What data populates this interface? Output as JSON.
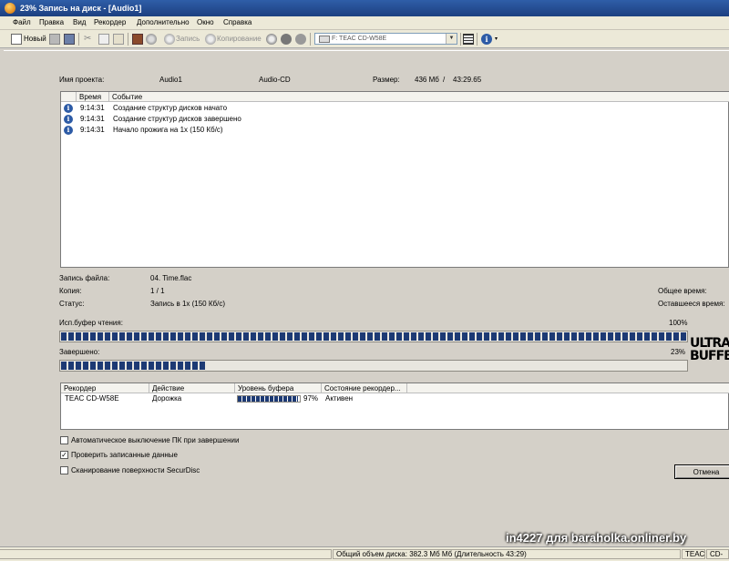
{
  "window": {
    "title": "23% Запись на диск - [Audio1]"
  },
  "menu": [
    "Файл",
    "Правка",
    "Вид",
    "Рекордер",
    "Дополнительно",
    "Окно",
    "Справка"
  ],
  "toolbar": {
    "new_label": "Новый",
    "burn_label": "Запись",
    "copy_label": "Копирование",
    "drive": "F: TEAC CD-W58E"
  },
  "project": {
    "name_label": "Имя проекта:",
    "name_value": "Audio1",
    "type": "Audio-CD",
    "size_label": "Размер:",
    "size_mb": "436 Мб",
    "size_sep": "/",
    "size_time": "43:29.65"
  },
  "log": {
    "columns": [
      "Время",
      "Событие"
    ],
    "rows": [
      {
        "time": "9:14:31",
        "event": "Создание структур дисков начато"
      },
      {
        "time": "9:14:31",
        "event": "Создание структур дисков завершено"
      },
      {
        "time": "9:14:31",
        "event": "Начало прожига на 1x (150 Кб/с)"
      }
    ]
  },
  "status": {
    "file_label": "Запись файла:",
    "file_value": "04. Time.flac",
    "copy_label": "Копия:",
    "copy_value": "1 / 1",
    "status_label": "Статус:",
    "status_value": "Запись в 1x (150 Кб/с)",
    "total_time_label": "Общее время:",
    "remaining_time_label": "Оставшееся время:"
  },
  "progress": {
    "buffer_label": "Исп.буфер чтения:",
    "buffer_pct_text": "100%",
    "buffer_value": 1.0,
    "done_label": "Завершено:",
    "done_pct_text": "23%",
    "done_value": 0.23
  },
  "logo_text": "ULTRA BUFFER",
  "recorder": {
    "columns": [
      "Рекордер",
      "Действие",
      "Уровень буфера",
      "Состояние рекордер..."
    ],
    "row": {
      "name": "TEAC CD-W58E",
      "action": "Дорожка",
      "buffer_pct_text": "97%",
      "buffer_value": 0.97,
      "state": "Активен"
    }
  },
  "options": [
    {
      "label": "Автоматическое выключение ПК при завершении",
      "checked": false
    },
    {
      "label": "Проверить записанные данные",
      "checked": true
    },
    {
      "label": "Сканирование поверхности SecurDisc",
      "checked": false
    }
  ],
  "cancel_label": "Отмена",
  "statusbar": {
    "total": "Общий объем диска: 382.3 Мб Мб (Длительность 43:29)",
    "drive": "TEAC",
    "drive2": "CD-W"
  },
  "watermark": "in4227 для baraholka.onliner.by"
}
